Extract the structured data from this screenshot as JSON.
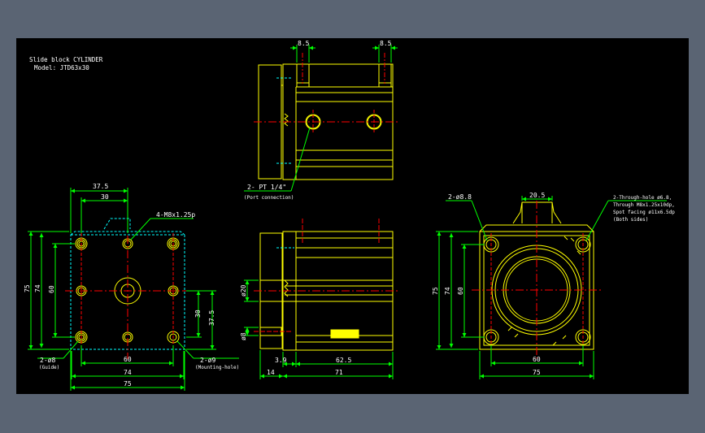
{
  "title": {
    "line1": "Slide block CYLINDER",
    "line2": "Model: JTD63x30"
  },
  "top_view": {
    "dim_left": "8.5",
    "dim_right": "8.5",
    "port_note": "2- PT 1/4\"",
    "port_sub": "(Port connection)"
  },
  "front_view": {
    "dim_37_5": "37.5",
    "dim_30": "30",
    "tap_note": "4-M8x1.25p",
    "dim_75_v": "75",
    "dim_74_v": "74",
    "dim_60_v": "60",
    "dim_30_v": "30",
    "dim_37_5_v": "37.5",
    "guide_note": "2-ø8",
    "guide_sub": "(Guide)",
    "mount_note": "2-ø9",
    "mount_sub": "(Mounting-hole)",
    "dim_60_h": "60",
    "dim_74_h": "74",
    "dim_75_h": "75"
  },
  "side_view": {
    "dim_phi20": "ø20",
    "dim_phi8": "ø8",
    "dim_3_9": "3.9",
    "dim_62_5": "62.5",
    "dim_14": "14",
    "dim_71": "71"
  },
  "back_view": {
    "hole_note": "2-ø8.8",
    "dim_20_5": "20.5",
    "thru_line1": "2-Through-hole ø6.8,",
    "thru_line2": "Through M8x1.25x10dp,",
    "thru_line3": "Spot facing ø11x6.5dp",
    "thru_line4": "(Both sides)",
    "dim_75_v": "75",
    "dim_74_v": "74",
    "dim_60_v": "60",
    "dim_60_h": "60",
    "dim_75_h": "75"
  },
  "colors": {
    "background": "#000000",
    "frame": "#5a6473",
    "outline": "#ffff00",
    "dimension": "#00ff00",
    "centerline": "#ff0000",
    "hidden": "#00ffff",
    "text": "#ffffff"
  }
}
